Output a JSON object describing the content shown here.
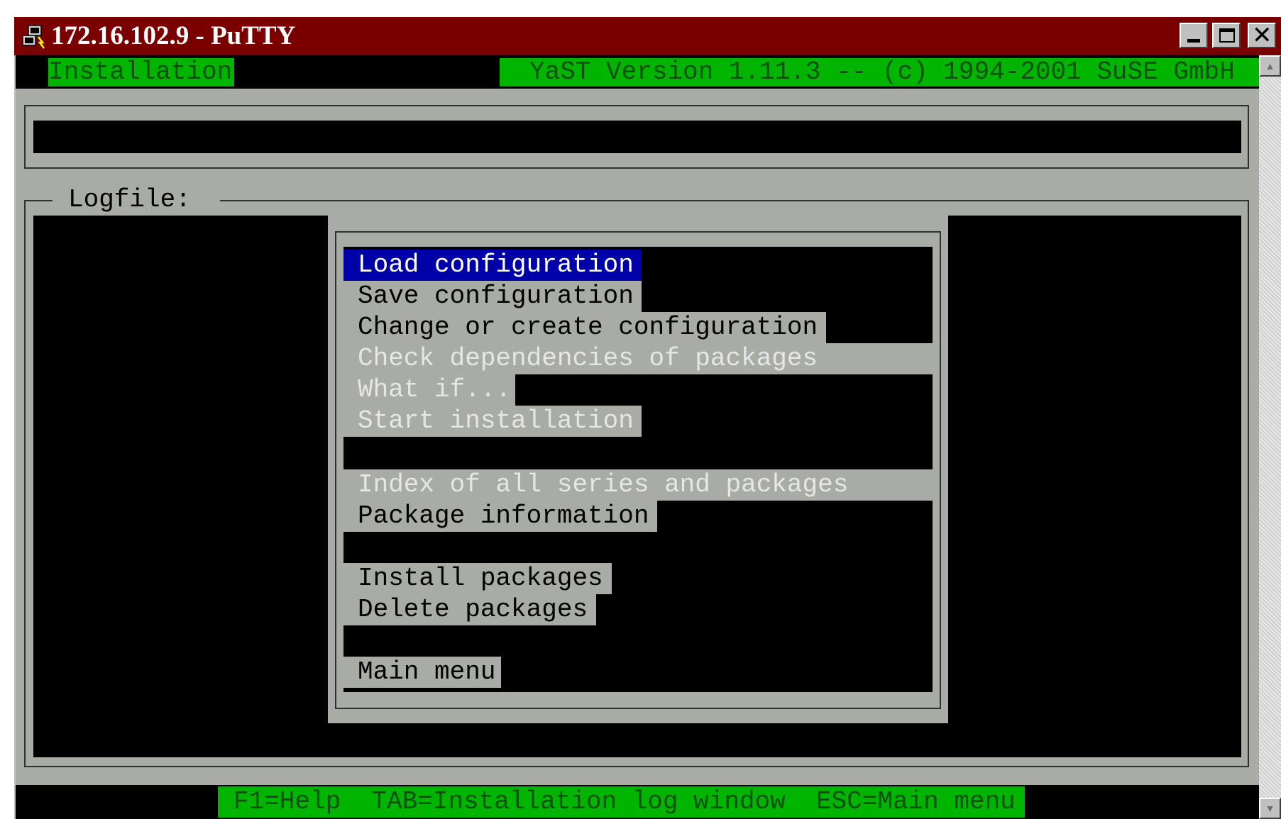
{
  "window": {
    "title": "172.16.102.9 - PuTTY",
    "icon": "putty-icon",
    "controls": [
      "minimize-icon",
      "maximize-icon",
      "close-icon"
    ],
    "close_glyph": "✕"
  },
  "terminal": {
    "header_left": "Installation",
    "header_right": "YaST Version 1.11.3 -- (c) 1994-2001 SuSE GmbH",
    "log_label": "Logfile:",
    "menu_items": [
      {
        "label": "Load configuration",
        "state": "selected"
      },
      {
        "label": "Save configuration",
        "state": "normal"
      },
      {
        "label": "Change or create configuration",
        "state": "normal"
      },
      {
        "label": "Check dependencies of packages",
        "state": "disabled"
      },
      {
        "label": "What if...",
        "state": "disabled"
      },
      {
        "label": "Start installation",
        "state": "disabled"
      },
      {
        "label": "Index of all series and packages",
        "state": "disabled"
      },
      {
        "label": "Package information",
        "state": "normal"
      },
      {
        "label": "Install packages",
        "state": "normal"
      },
      {
        "label": "Delete packages",
        "state": "normal"
      },
      {
        "label": "Main menu",
        "state": "normal"
      }
    ],
    "hints": "F1=Help  TAB=Installation log window  ESC=Main menu"
  },
  "colors": {
    "titlebar": "#7a0000",
    "terminal_grey": "#a9aca4",
    "header_green": "#00b400",
    "selection_blue": "#0000a8"
  }
}
